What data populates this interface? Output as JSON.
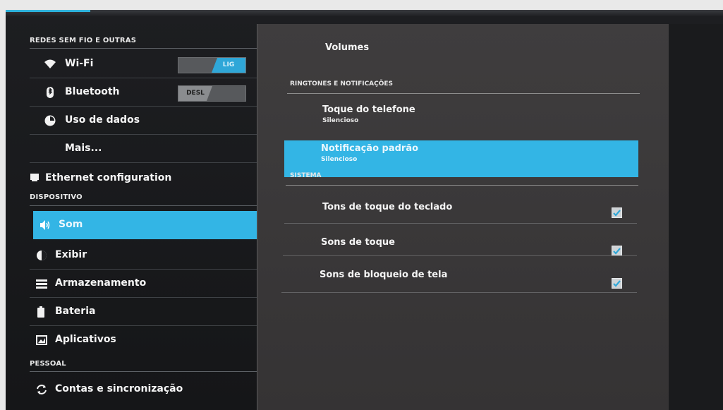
{
  "left": {
    "section_wireless": "REDES SEM FIO E OUTRAS",
    "wifi": {
      "label": "Wi-Fi",
      "toggle": "LIG"
    },
    "bluetooth": {
      "label": "Bluetooth",
      "toggle": "DESL"
    },
    "data_usage": "Uso de dados",
    "more": "Mais...",
    "ethernet": "Ethernet configuration",
    "section_device": "DISPOSITIVO",
    "sound": "Som",
    "display": "Exibir",
    "storage": "Armazenamento",
    "battery": "Bateria",
    "apps": "Aplicativos",
    "section_personal": "PESSOAL",
    "accounts": "Contas e sincronização"
  },
  "right": {
    "volumes": "Volumes",
    "section_ringtones": "RINGTONES E NOTIFICAÇÕES",
    "phone_ringtone": {
      "title": "Toque do telefone",
      "value": "Silencioso"
    },
    "default_notification": {
      "title": "Notificação padrão",
      "value": "Silencioso"
    },
    "section_system": "SISTEMA",
    "keyboard_tones": {
      "title": "Tons de toque do teclado",
      "checked": true
    },
    "touch_sounds": {
      "title": "Sons de toque",
      "checked": true
    },
    "screen_lock_sounds": {
      "title": "Sons de bloqueio de tela",
      "checked": true
    }
  },
  "colors": {
    "accent": "#33b5e5",
    "panel": "#3d3b3c",
    "background": "#1b1c1f"
  },
  "icons": {
    "wifi": "wifi-icon",
    "bluetooth": "bluetooth-icon",
    "data_usage": "data-usage-icon",
    "ethernet": "ethernet-icon",
    "sound": "speaker-icon",
    "display": "brightness-icon",
    "storage": "storage-icon",
    "battery": "battery-icon",
    "apps": "apps-icon",
    "accounts": "sync-icon"
  }
}
